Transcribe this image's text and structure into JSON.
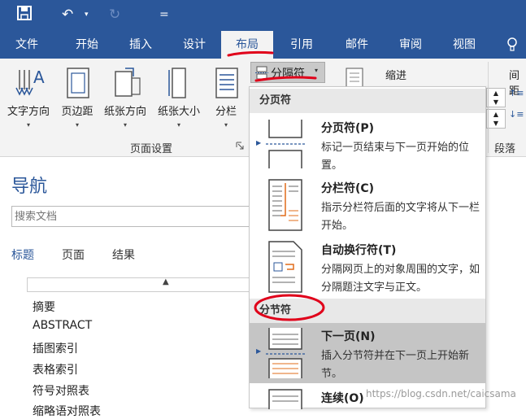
{
  "quick_access": {
    "customize": "="
  },
  "tabs": [
    "文件",
    "开始",
    "插入",
    "设计",
    "布局",
    "引用",
    "邮件",
    "审阅",
    "视图"
  ],
  "tab_help_icon": "lightbulb-icon",
  "ribbon": {
    "buttons": [
      "文字方向",
      "页边距",
      "纸张方向",
      "纸张大小",
      "分栏"
    ],
    "breaks_button": "分隔符",
    "indent_label": "缩进",
    "spacing_label": "间距",
    "page_setup_group": "页面设置",
    "paragraph_group": "段落"
  },
  "nav": {
    "title": "导航",
    "search_placeholder": "搜索文档",
    "tabs": [
      "标题",
      "页面",
      "结果"
    ],
    "headings": [
      "摘要",
      "ABSTRACT",
      "插图索引",
      "表格索引",
      "符号对照表",
      "缩略语对照表"
    ]
  },
  "breaks_menu": {
    "page_breaks_header": "分页符",
    "section_breaks_header": "分节符",
    "items": [
      {
        "title": "分页符(P)",
        "desc": "标记一页结束与下一页开始的位置。"
      },
      {
        "title": "分栏符(C)",
        "desc": "指示分栏符后面的文字将从下一栏开始。"
      },
      {
        "title": "自动换行符(T)",
        "desc": "分隔网页上的对象周围的文字，如分隔题注文字与正文。"
      },
      {
        "title": "下一页(N)",
        "desc": "插入分节符并在下一页上开始新节。"
      },
      {
        "title": "连续(O)",
        "desc": ""
      }
    ]
  },
  "watermark": "https://blog.csdn.net/caicsama",
  "colors": {
    "ribbon_blue": "#2b579a",
    "highlight": "#c5c5c5",
    "annotation_red": "#e0001a"
  }
}
